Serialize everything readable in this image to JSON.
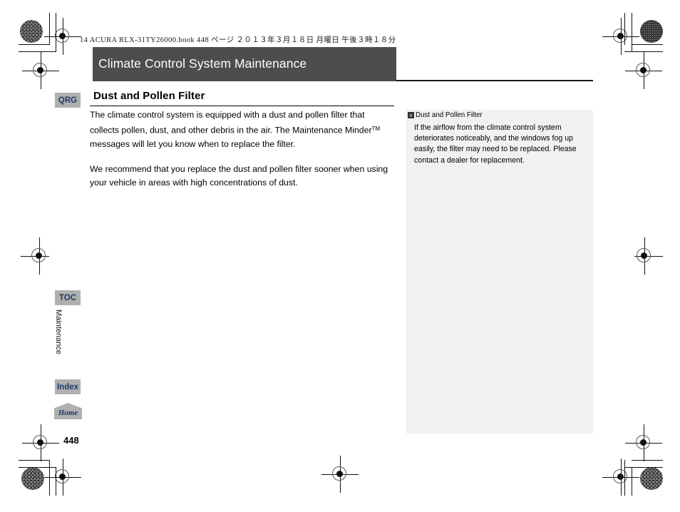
{
  "print_header": {
    "file_line": "14 ACURA RLX-31TY26000.book",
    "page_ref": "448 ページ",
    "date": "２０１３年３月１８日",
    "weekday": "月曜日",
    "time": "午後３時１８分",
    "full_line": "14 ACURA RLX-31TY26000.book   448 ページ   ２０１３年３月１８日   月曜日   午後３時１８分"
  },
  "chapter": {
    "title": "Climate Control System Maintenance",
    "bar_color": "#4d4d4d",
    "text_color": "#ffffff"
  },
  "sidebar": {
    "buttons": [
      {
        "id": "qrg",
        "label": "QRG"
      },
      {
        "id": "toc",
        "label": "TOC"
      },
      {
        "id": "index",
        "label": "Index"
      },
      {
        "id": "home",
        "label": "Home"
      }
    ],
    "section_tab_label": "Maintenance",
    "button_bg": "#b0b0b0",
    "button_text_color": "#1f3864"
  },
  "main": {
    "section_title": "Dust and Pollen Filter",
    "paragraphs": [
      "The climate control system is equipped with a dust and pollen filter that collects pollen, dust, and other debris in the air. The Maintenance Minder",
      "We recommend that you replace the dust and pollen filter sooner when using your vehicle in areas with high concentrations of dust."
    ],
    "paragraph1_trademark": "TM",
    "paragraph1_tail": " messages will let you know when to replace the filter."
  },
  "note_panel": {
    "marker_icon": "double-chevron-icon",
    "marker_glyph": "»",
    "title": "Dust and Pollen Filter",
    "body": "If the airflow from the climate control system deteriorates noticeably, and the windows fog up easily, the filter may need to be replaced. Please contact a dealer for replacement.",
    "bg_color": "#f1f1f1"
  },
  "footer": {
    "page_number": "448"
  }
}
